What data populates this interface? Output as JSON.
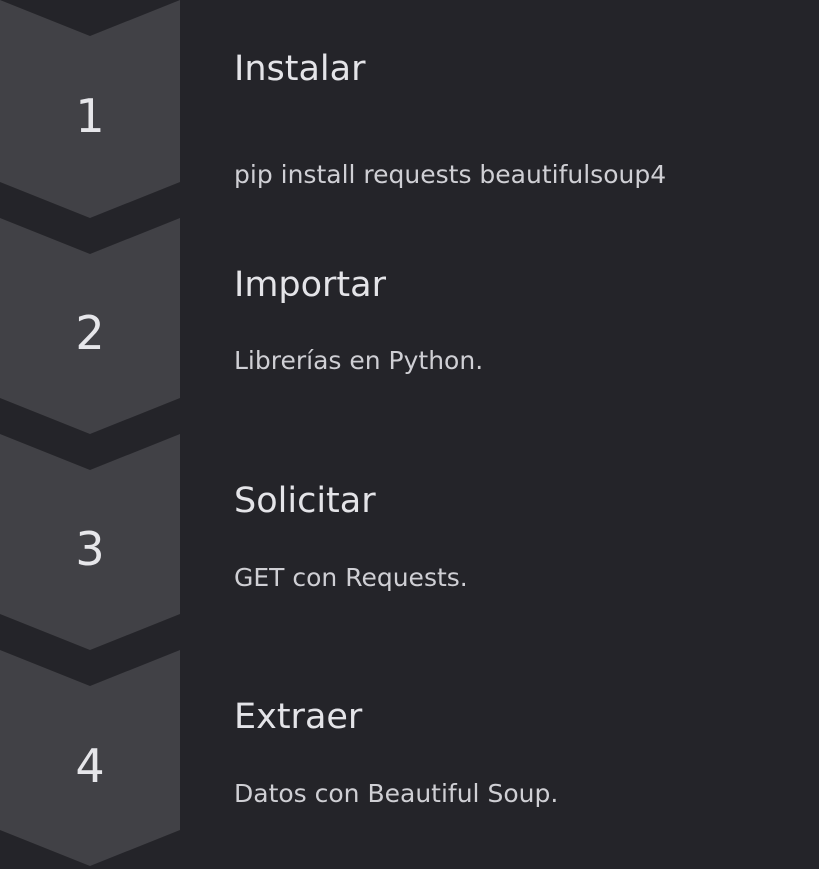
{
  "steps": [
    {
      "number": "1",
      "title": "Instalar",
      "description": "pip install requests beautifulsoup4"
    },
    {
      "number": "2",
      "title": "Importar",
      "description": "Librerías en Python."
    },
    {
      "number": "3",
      "title": "Solicitar",
      "description": "GET con Requests."
    },
    {
      "number": "4",
      "title": "Extraer",
      "description": "Datos con Beautiful Soup."
    }
  ],
  "colors": {
    "background": "#242429",
    "chevron_fill": "#414146",
    "number_text": "#e6e6ea",
    "title_text": "#e4e4e8",
    "description_text": "#cfcfd4"
  }
}
